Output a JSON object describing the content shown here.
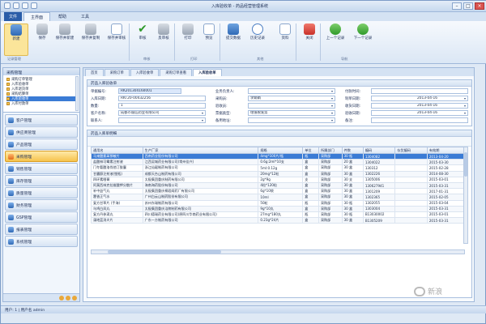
{
  "window": {
    "title": "入库验收单 - 药品经营管理系统"
  },
  "ribbon_tabs": [
    {
      "label": "文件"
    },
    {
      "label": "主界面"
    },
    {
      "label": "帮助"
    },
    {
      "label": "工具"
    }
  ],
  "ribbon": {
    "buttons": [
      {
        "label": "新建"
      },
      {
        "label": "保存"
      },
      {
        "label": "保存并新建"
      },
      {
        "label": "保存并复制"
      },
      {
        "label": "保存并审核"
      },
      {
        "label": "审核"
      },
      {
        "label": "反审核"
      },
      {
        "label": "打印"
      },
      {
        "label": "预览"
      },
      {
        "label": "提交数据"
      },
      {
        "label": "历史记录"
      },
      {
        "label": "资料"
      },
      {
        "label": "关闭"
      },
      {
        "label": "上一个记录"
      },
      {
        "label": "下一个记录"
      }
    ],
    "groups": [
      "记录管理",
      "审核",
      "打印",
      "其他",
      "导航"
    ]
  },
  "sidebar": {
    "header": "采购管理",
    "tree": [
      "采购订单管理",
      "入库验收单",
      "入库退货单",
      "采购结算单",
      "入库验收单",
      "入库付款单"
    ],
    "nav": [
      "客户管理",
      "供应商管理",
      "产品管理",
      "采购管理",
      "销售管理",
      "库存管理",
      "质量管理",
      "财务管理",
      "GSP管理",
      "报表管理",
      "系统管理"
    ]
  },
  "doc_tabs": [
    "首页",
    "采购订单",
    "入库验收单",
    "采购订单查看",
    "入库验收单"
  ],
  "form": {
    "header": "药品入库验收单",
    "labels": {
      "code": "单据编号:",
      "date": "入库日期:",
      "amount": "数量:",
      "supplier": "客户名称:",
      "contact": "联系人:",
      "buyer": "业务负责人:",
      "checker": "采购员:",
      "store": "验收员:",
      "pay_type": "票据类型:",
      "address": "备用地址:",
      "verify_date": "付款时间:",
      "invoice_date": "制单日期:",
      "receive_date": "收货日期:",
      "check_date": "验收日期:",
      "note": "备注:"
    },
    "values": {
      "code": "RK201304160001",
      "date": "RKT20-00432256",
      "amount": "1",
      "supplier": "成都市诚信药业有限公司",
      "checker": "李娟娟",
      "pay_type": "增值税发票",
      "invoice_date": "2013-04-16",
      "receive_date": "2013-04-16",
      "check_date": "2013-04-16"
    }
  },
  "grid": {
    "header": "药品入库单明细",
    "columns": [
      "通用名",
      "生产厂家",
      "规格",
      "单位",
      "所属部门",
      "件数",
      "编码",
      "存货编码",
      "有效期"
    ],
    "rows": [
      [
        "马来酸氯苯那敏片",
        "西南药业股份有限公司",
        "4mg*100片/瓶",
        "瓶",
        "采购部",
        "30 瓶",
        "1304082",
        "2013-04-20"
      ],
      [
        "盐酸林可霉素注射液",
        "江西吴城药业有限公司(常州佳兴)",
        "0.6g:2ml*10支",
        "盒",
        "采购部",
        "20 盒",
        "1304022",
        "2015-03-30"
      ],
      [
        "门冬氨酸洛伐他汀胶囊",
        "浙江仙琚制药有限公司",
        "5ml:0.12g",
        "盒",
        "采购部",
        "30 盒",
        "130312",
        "2015-02-28"
      ],
      [
        "甘露醇注射液(塑瓶)",
        "成都天台山制药有限公司",
        "20mg*12粒",
        "盒",
        "采购部",
        "30 盒",
        "1302226",
        "2014-08-30"
      ],
      [
        "四环素眼膏",
        "太极集团重庆制药有限公司",
        "2g*9g",
        "支",
        "采购部",
        "30 支",
        "1305006",
        "2015-03-01"
      ],
      [
        "阿莫西林克拉维酸钾分散片",
        "海南海药股份有限公司",
        "4粒*120粒",
        "盒",
        "采购部",
        "30 盒",
        "130627941",
        "2015-03-31"
      ],
      [
        "补中益气丸",
        "太极集团重庆桐君阁药厂有限公司",
        "6g*10袋",
        "盒",
        "采购部",
        "30 盒",
        "1301209",
        "2017-01-31"
      ],
      [
        "藿香正气水",
        "广州白云山制药股份有限公司",
        "10ml",
        "盒",
        "采购部",
        "30 盒",
        "1302365",
        "2015-02-05"
      ],
      [
        "复方甘草片 (手海)",
        "苏州东瑞制药有限公司",
        "50粒",
        "瓶",
        "采购部",
        "30 瓶",
        "1302055",
        "2015-03-04"
      ],
      [
        "乌鸡白凤丸",
        "太极集团重庆涪陵制药有限公司",
        "9g*10丸",
        "盒",
        "采购部",
        "30 盒",
        "1303004",
        "2015-03-31"
      ],
      [
        "复方丹参滴丸",
        "四川德瑞药业有限公司(原四川华南药业有限公司)",
        "27mg*180丸",
        "瓶",
        "采购部",
        "30 瓶",
        "B13030002",
        "2015-03-01"
      ],
      [
        "蒲地蓝消炎片",
        "广东一方制药有限公司",
        "0.23g*24片",
        "盒",
        "采购部",
        "30 盒",
        "B1305209",
        "2015-03-31"
      ]
    ]
  },
  "status": {
    "text": "用户: 1  | 用户名 admin"
  },
  "watermark": {
    "text": "新浪"
  }
}
